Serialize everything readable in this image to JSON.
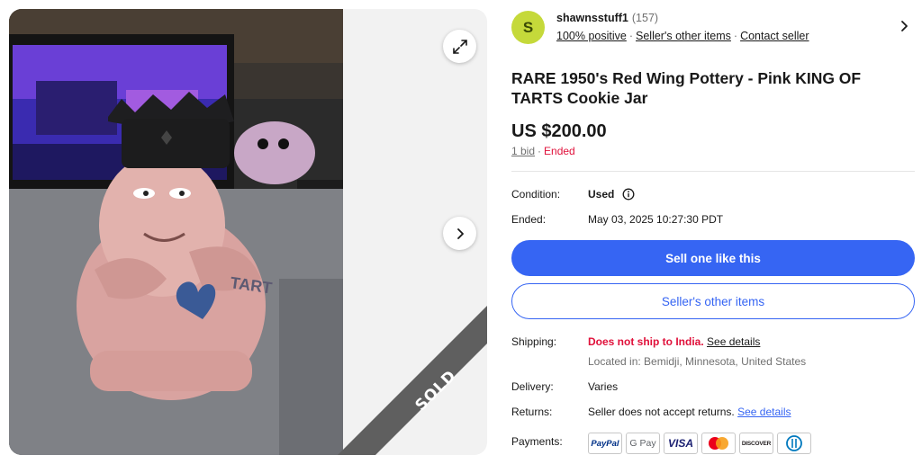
{
  "seller": {
    "avatar_letter": "S",
    "name": "shawnsstuff1",
    "feedback_count": "(157)",
    "positive": "100% positive",
    "other_items": "Seller's other items",
    "contact": "Contact seller"
  },
  "gallery": {
    "sold_label": "SOLD",
    "expand_icon": "expand-icon",
    "next_icon": "chevron-right-icon"
  },
  "listing": {
    "title": "RARE 1950's Red Wing Pottery - Pink KING OF TARTS Cookie Jar",
    "price": "US $200.00",
    "bids": "1 bid",
    "status": "Ended"
  },
  "details": {
    "condition_label": "Condition:",
    "condition_value": "Used",
    "ended_label": "Ended:",
    "ended_value": "May 03, 2025 10:27:30 PDT"
  },
  "actions": {
    "sell_like": "Sell one like this",
    "other_items": "Seller's other items"
  },
  "shipping": {
    "label": "Shipping:",
    "warning": "Does not ship to India.",
    "see_details": "See details",
    "location": "Located in: Bemidji, Minnesota, United States"
  },
  "delivery": {
    "label": "Delivery:",
    "value": "Varies"
  },
  "returns": {
    "label": "Returns:",
    "value": "Seller does not accept returns.",
    "see_details": "See details"
  },
  "payments": {
    "label": "Payments:",
    "methods": [
      "PayPal",
      "G Pay",
      "VISA",
      "Mastercard",
      "DISCOVER",
      "Diners Club"
    ]
  },
  "colors": {
    "accent": "#3665f3",
    "alert": "#e0103a",
    "avatar": "#c5d93a"
  }
}
